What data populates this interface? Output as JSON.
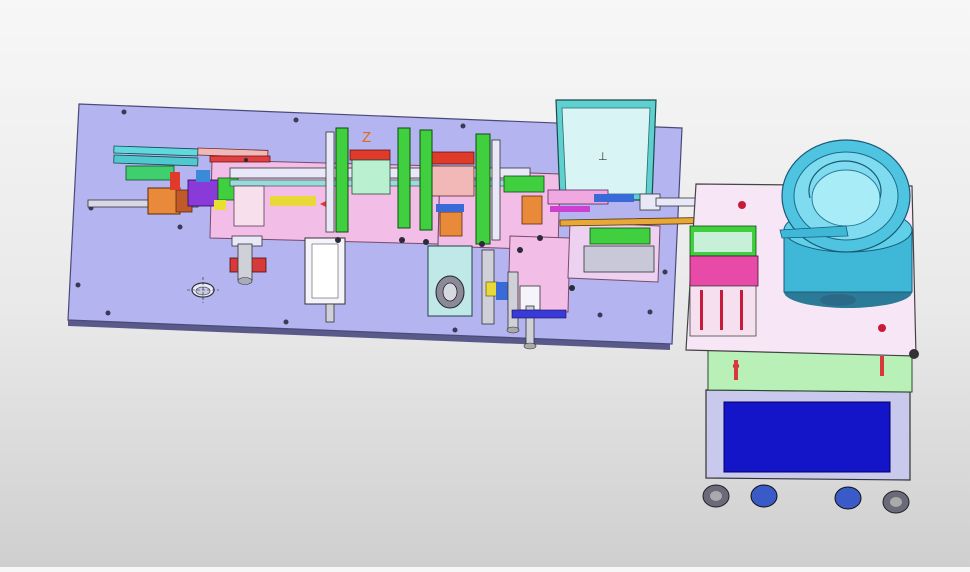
{
  "viewport": {
    "background_top": "#f7f7f7",
    "background_bottom": "#cfcfcf"
  },
  "model": {
    "axis_label": "Z",
    "palette": {
      "base_plate": "#b3b4f0",
      "plate_edge": "#4a4a7a",
      "pink_plate": "#f2bde6",
      "green": "#3fcf3f",
      "red": "#e03a2a",
      "cyan": "#3fd0d0",
      "bowl": "#3fb8d8",
      "cabinet": "#c9c9ee",
      "cabinet_panel": "#1414c8",
      "cabinet_top": "#b8f0b8",
      "orange": "#e88a3a",
      "yellow": "#f0e030",
      "magenta": "#d040d0"
    }
  }
}
